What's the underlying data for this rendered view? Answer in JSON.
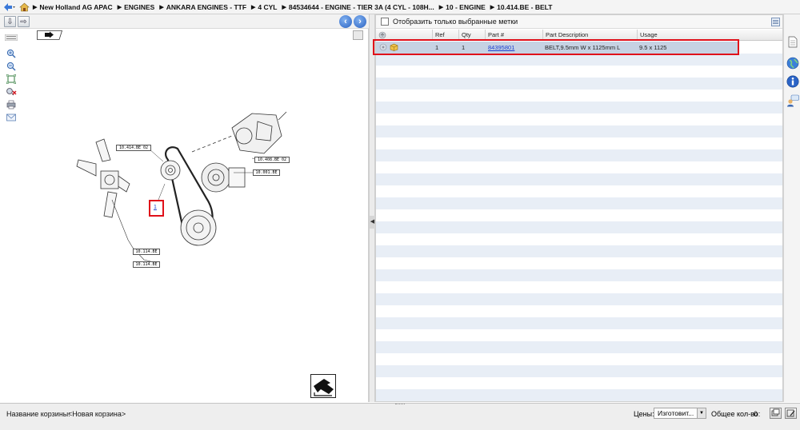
{
  "breadcrumb": {
    "items": [
      "New Holland AG APAC",
      "ENGINES",
      "ANKARA ENGINES - TTF",
      "4 CYL",
      "84534644 - ENGINE - TIER 3A (4 CYL - 108H...",
      "10 - ENGINE",
      "10.414.BE - BELT"
    ]
  },
  "left_toolbar": {
    "icons": [
      "zoom-in-icon",
      "zoom-out-icon",
      "fit-icon",
      "clear-icon",
      "print-icon",
      "email-icon"
    ]
  },
  "diagram": {
    "callout_refs": [
      "10.414.BE 02",
      "10.408.BE 02",
      "10.001.BE",
      "10.114.BE",
      "10.114.BE"
    ],
    "selected_ref": "1"
  },
  "filter": {
    "label": "Отобразить только выбранные метки"
  },
  "table": {
    "columns": [
      "",
      "Ref",
      "Qty",
      "Part #",
      "Part Description",
      "Usage"
    ],
    "rows": [
      {
        "ref": "1",
        "qty": "1",
        "part_no": "84395801",
        "description": "BELT,9.5mm W x 1125mm L",
        "usage": "9.5 x 1125"
      }
    ]
  },
  "status": {
    "basket_label": "Название корзины:",
    "basket_name": "<Новая корзина>",
    "prices_label": "Цены:",
    "prices_value": "Изготовит...",
    "total_label": "Общее кол-во:",
    "total_value": "0"
  },
  "colors": {
    "selection_border": "#e0101a",
    "selection_fill": "#c6d2e3",
    "stripe": "#e8eef6",
    "link": "#1a3fd0"
  }
}
